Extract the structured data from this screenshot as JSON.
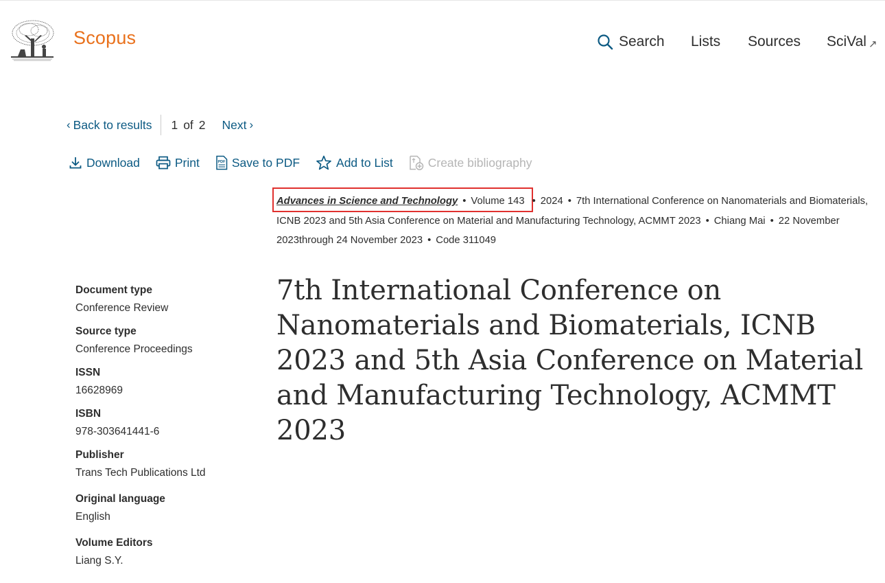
{
  "header": {
    "brand": "Scopus",
    "nav": [
      {
        "label": "Search",
        "icon": "search-icon"
      },
      {
        "label": "Lists"
      },
      {
        "label": "Sources"
      },
      {
        "label": "SciVal",
        "icon": "external-link-icon"
      }
    ]
  },
  "pager": {
    "back_label": "Back to results",
    "current": "1",
    "of_label": "of",
    "total": "2",
    "next_label": "Next"
  },
  "actions": {
    "download": "Download",
    "print": "Print",
    "save_pdf": "Save to PDF",
    "add_list": "Add to List",
    "create_bibliography": "Create bibliography"
  },
  "source": {
    "journal": "Advances in Science and Technology",
    "volume": "Volume 143",
    "year": "2024",
    "conference": "7th International Conference on Nanomaterials and Biomaterials, ICNB 2023 and 5th Asia Conference on Material and Manufacturing Technology, ACMMT 2023",
    "location": "Chiang Mai",
    "dates": "22 November 2023through 24 November 2023",
    "code": "Code 311049"
  },
  "meta": {
    "document_type_label": "Document type",
    "document_type": "Conference Review",
    "source_type_label": "Source type",
    "source_type": "Conference Proceedings",
    "issn_label": "ISSN",
    "issn": "16628969",
    "isbn_label": "ISBN",
    "isbn": "978-303641441-6",
    "publisher_label": "Publisher",
    "publisher": "Trans Tech Publications Ltd",
    "language_label": "Original language",
    "language": "English",
    "editors_label": "Volume Editors",
    "editors": "Liang S.Y."
  },
  "document": {
    "title": "7th International Conference on Nanomaterials and Biomaterials, ICNB 2023 and 5th Asia Conference on Material and Manufacturing Technology, ACMMT 2023"
  },
  "colors": {
    "brand": "#e9711c",
    "link": "#0c5a83",
    "highlight": "#e0302e",
    "text": "#2e2e2e",
    "disabled": "#b5b5b5"
  }
}
